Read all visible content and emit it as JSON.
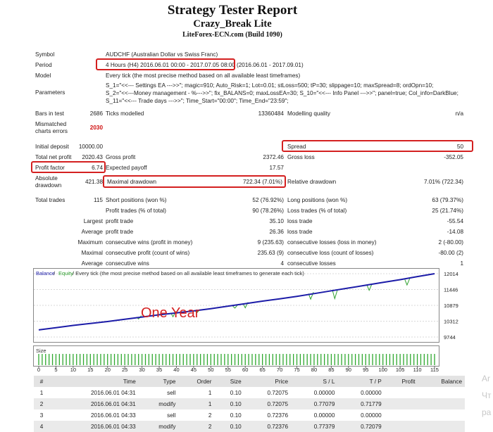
{
  "header": {
    "title": "Strategy Tester Report",
    "subtitle": "Crazy_Break Lite",
    "server": "LiteForex-ECN.com (Build 1090)"
  },
  "settings": {
    "symbol_label": "Symbol",
    "symbol_value": "AUDCHF (Australian Dollar vs Swiss Franc)",
    "period_label": "Period",
    "period_value": "4 Hours (H4) 2016.06.01 00:00 - 2017.07.05 08:00",
    "period_extra": "(2016.06.01 - 2017.09.01)",
    "model_label": "Model",
    "model_value": "Every tick (the most precise method based on all available least timeframes)",
    "parameters_label": "Parameters",
    "parameters_lines": [
      "S_1=\"<<--- Settings EA --->>\"; magic=910; Auto_Risk=1; Lot=0.01; stLoss=500; tP=30; slippage=10; maxSpread=8; ordOpn=10;",
      "S_2=\"<<---Money management - %--->>\"; fix_BALANS=0; maxLossEA=30; S_10=\"<<--- Info Panel --->>\"; panel=true; Col_info=DarkBlue;",
      "S_11=\"<<--- Trade days --->>\"; Time_Start=\"00:00\"; Time_End=\"23:59\";"
    ]
  },
  "stats": {
    "bars_label": "Bars in test",
    "bars_value": "2686",
    "ticks_label": "Ticks modelled",
    "ticks_value": "13360484",
    "quality_label": "Modelling quality",
    "quality_value": "n/a",
    "mismatch_label_1": "Mismatched",
    "mismatch_label_2": "charts errors",
    "mismatch_value": "2030",
    "deposit_label": "Initial deposit",
    "deposit_value": "10000.00",
    "spread_label": "Spread",
    "spread_value": "50",
    "netprofit_label": "Total net profit",
    "netprofit_value": "2020.43",
    "grossprofit_label": "Gross profit",
    "grossprofit_value": "2372.46",
    "grossloss_label": "Gross loss",
    "grossloss_value": "-352.05",
    "pf_label": "Profit factor",
    "pf_value": "6.74",
    "payoff_label": "Expected payoff",
    "payoff_value": "17.57",
    "absdd_label_1": "Absolute",
    "absdd_label_2": "drawdown",
    "absdd_value": "421.38",
    "maxdd_label": "Maximal drawdown",
    "maxdd_value": "722.34 (7.01%)",
    "reldd_label": "Relative drawdown",
    "reldd_value": "7.01% (722.34)",
    "totaltrades_label": "Total trades",
    "totaltrades_value": "115",
    "short_label": "Short positions (won %)",
    "short_value": "52 (76.92%)",
    "long_label": "Long positions (won %)",
    "long_value": "63 (79.37%)",
    "profittrades_label": "Profit trades (% of total)",
    "profittrades_value": "90 (78.26%)",
    "losstrades_label": "Loss trades (% of total)",
    "losstrades_value": "25 (21.74%)",
    "largest_label": "Largest",
    "largest_profit_label": "profit trade",
    "largest_profit_value": "35.10",
    "largest_loss_label": "loss trade",
    "largest_loss_value": "-55.54",
    "average_label": "Average",
    "average_profit_label": "profit trade",
    "average_profit_value": "26.36",
    "average_loss_label": "loss trade",
    "average_loss_value": "-14.08",
    "maximum_label": "Maximum",
    "max_wins_label": "consecutive wins (profit in money)",
    "max_wins_value": "9 (235.63)",
    "max_losses_label": "consecutive losses (loss in money)",
    "max_losses_value": "2 (-80.00)",
    "maximal_label": "Maximal",
    "maximal_profit_label": "consecutive profit (count of wins)",
    "maximal_profit_value": "235.63 (9)",
    "maximal_loss_label": "consecutive loss (count of losses)",
    "maximal_loss_value": "-80.00 (2)",
    "avg_label": "Average",
    "avg_wins_label": "consecutive wins",
    "avg_wins_value": "4",
    "avg_losses_label": "consecutive losses",
    "avg_losses_value": "1"
  },
  "chart_data": {
    "type": "line",
    "legend_balance": "Balance",
    "legend_sep": " / ",
    "legend_equity": "Equity",
    "legend_rest": " / Every tick (the most precise method based on all available least timeframes to generate each tick)",
    "annotation": "One Year",
    "size_label": "Size",
    "y_ticks": [
      "12014",
      "11446",
      "10879",
      "10312",
      "9744"
    ],
    "x_ticks": [
      "0",
      "5",
      "10",
      "15",
      "20",
      "25",
      "30",
      "35",
      "40",
      "45",
      "50",
      "55",
      "60",
      "65",
      "70",
      "75",
      "80",
      "85",
      "90",
      "95",
      "100",
      "105",
      "110",
      "115"
    ],
    "ylim": [
      9744,
      12014
    ],
    "xlim": [
      0,
      115
    ],
    "series": [
      {
        "name": "Balance",
        "color": "#1c1ca8",
        "x": [
          0,
          5,
          10,
          15,
          20,
          25,
          30,
          35,
          40,
          45,
          50,
          55,
          60,
          65,
          70,
          75,
          80,
          85,
          90,
          95,
          100,
          105,
          110,
          115
        ],
        "values": [
          10000,
          10080,
          10160,
          10230,
          10300,
          10380,
          10460,
          10540,
          10610,
          10680,
          10760,
          10850,
          10940,
          11030,
          11110,
          11200,
          11300,
          11400,
          11500,
          11600,
          11700,
          11800,
          11910,
          12014
        ]
      },
      {
        "name": "Equity",
        "color": "#30a030",
        "x": [
          29,
          39,
          46,
          57,
          60,
          79,
          86,
          96,
          107
        ],
        "values": [
          10390,
          10470,
          10620,
          10780,
          10790,
          11100,
          11120,
          11420,
          11610
        ]
      }
    ]
  },
  "trades": {
    "columns": [
      "#",
      "Time",
      "Type",
      "Order",
      "Size",
      "Price",
      "S / L",
      "T / P",
      "Profit",
      "Balance"
    ],
    "rows": [
      [
        "1",
        "2016.06.01 04:31",
        "sell",
        "1",
        "0.10",
        "0.72075",
        "0.00000",
        "0.00000",
        "",
        ""
      ],
      [
        "2",
        "2016.06.01 04:31",
        "modify",
        "1",
        "0.10",
        "0.72075",
        "0.77079",
        "0.71779",
        "",
        ""
      ],
      [
        "3",
        "2016.06.01 04:33",
        "sell",
        "2",
        "0.10",
        "0.72376",
        "0.00000",
        "0.00000",
        "",
        ""
      ],
      [
        "4",
        "2016.06.01 04:33",
        "modify",
        "2",
        "0.10",
        "0.72376",
        "0.77379",
        "0.72079",
        "",
        ""
      ]
    ]
  },
  "ghost_text": [
    "Ar",
    "Чт",
    "ра"
  ]
}
